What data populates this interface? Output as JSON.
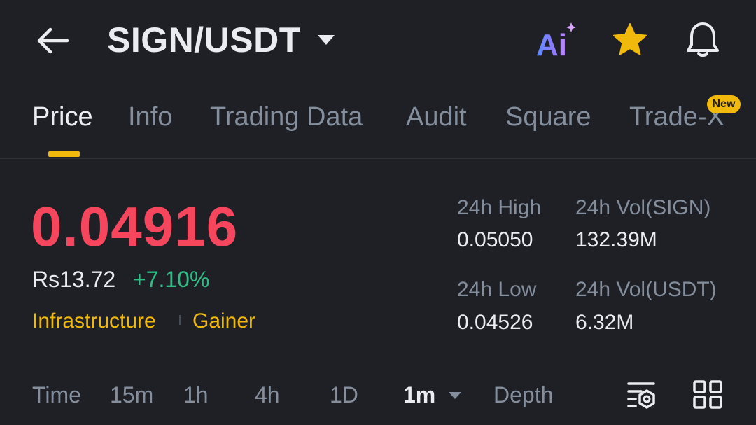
{
  "header": {
    "pair": "SIGN/USDT",
    "icons": [
      "back-arrow-icon",
      "chevron-down-icon",
      "ai-assistant-icon",
      "star-icon",
      "bell-icon"
    ],
    "ai_label": "Ai"
  },
  "tabs": [
    {
      "label": "Price",
      "active": true
    },
    {
      "label": "Info"
    },
    {
      "label": "Trading Data"
    },
    {
      "label": "Audit"
    },
    {
      "label": "Square"
    },
    {
      "label": "Trade-X",
      "badge": "New"
    }
  ],
  "price": {
    "last": "0.04916",
    "fiat": "Rs13.72",
    "change": "+7.10%",
    "tags": [
      "Infrastructure",
      "Gainer"
    ]
  },
  "stats": {
    "high_label": "24h High",
    "high_value": "0.05050",
    "vol_base_label": "24h Vol(SIGN)",
    "vol_base_value": "132.39M",
    "low_label": "24h Low",
    "low_value": "0.04526",
    "vol_quote_label": "24h Vol(USDT)",
    "vol_quote_value": "6.32M"
  },
  "timeframes": {
    "items": [
      "Time",
      "15m",
      "1h",
      "4h",
      "1D",
      "1m",
      "Depth"
    ],
    "selected": "1m",
    "tool_icons": [
      "chart-settings-icon",
      "grid-layout-icon"
    ]
  },
  "colors": {
    "background": "#1e2026",
    "price_down": "#f6465d",
    "price_up": "#2ebd85",
    "accent": "#f0b90b",
    "muted": "#848e9c"
  }
}
